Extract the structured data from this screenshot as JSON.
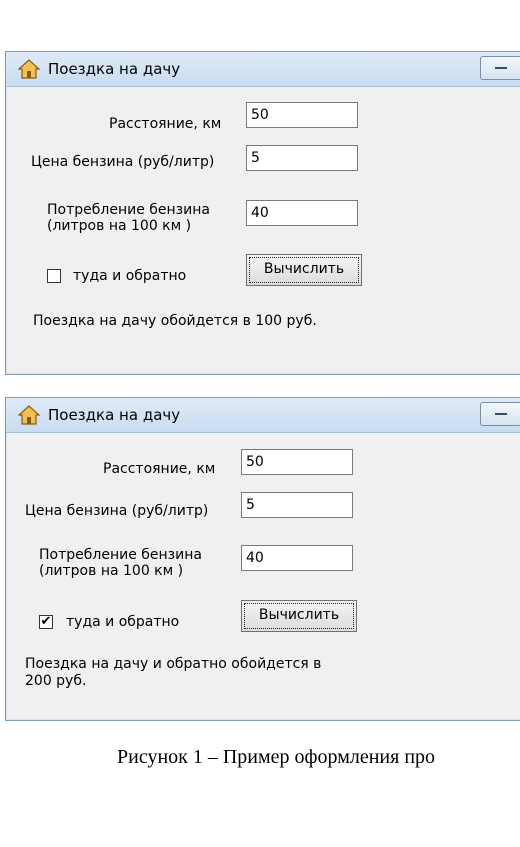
{
  "windows": [
    {
      "title": "Поездка на дачу",
      "distance_label": "Расстояние, км",
      "distance_value": "50",
      "price_label": "Цена бензина (руб/литр)",
      "price_value": "5",
      "consumption_label_line1": "Потребление бензина",
      "consumption_label_line2": "(литров на 100 км )",
      "consumption_value": "40",
      "roundtrip_label": "туда и обратно",
      "roundtrip_checked": false,
      "calculate_label": "Вычислить",
      "result_line1": "Поездка на дачу  обойдется в 100 руб.",
      "result_line2": ""
    },
    {
      "title": "Поездка на дачу",
      "distance_label": "Расстояние, км",
      "distance_value": "50",
      "price_label": "Цена бензина (руб/литр)",
      "price_value": "5",
      "consumption_label_line1": "Потребление бензина",
      "consumption_label_line2": "(литров на 100 км )",
      "consumption_value": "40",
      "roundtrip_label": "туда и обратно",
      "roundtrip_checked": true,
      "calculate_label": "Вычислить",
      "result_line1": "Поездка на дачу  и обратно  обойдется в",
      "result_line2": "200 руб."
    }
  ],
  "check_mark": "✔",
  "caption": "Рисунок 1 – Пример оформления про"
}
